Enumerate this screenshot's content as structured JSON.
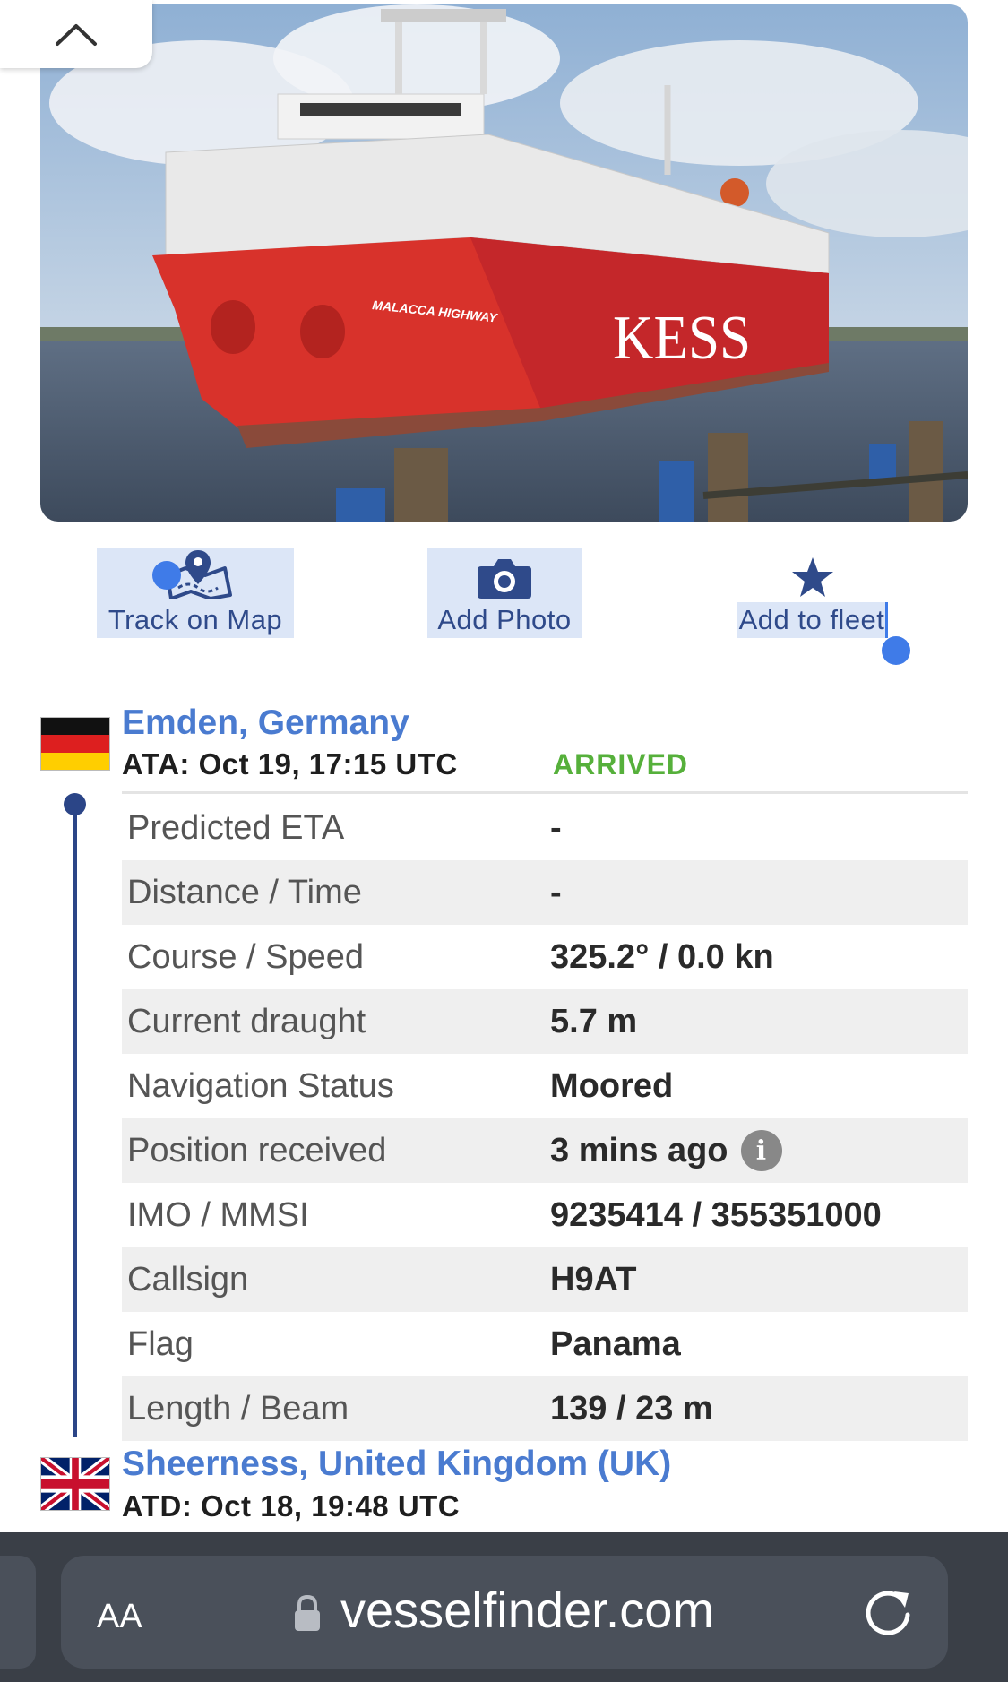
{
  "actions": {
    "track": "Track on Map",
    "photo": "Add Photo",
    "fleet": "Add to fleet"
  },
  "arrival": {
    "port": "Emden, Germany",
    "time": "ATA: Oct 19, 17:15 UTC",
    "status": "ARRIVED",
    "status_color": "#56b03b"
  },
  "departure": {
    "port": "Sheerness, United Kingdom (UK)",
    "time": "ATD: Oct 18, 19:48 UTC"
  },
  "details": [
    {
      "key": "Predicted ETA",
      "value": "-"
    },
    {
      "key": "Distance / Time",
      "value": "-"
    },
    {
      "key": "Course / Speed",
      "value": "325.2° / 0.0 kn"
    },
    {
      "key": "Current draught",
      "value": "5.7 m"
    },
    {
      "key": "Navigation Status",
      "value": "Moored"
    },
    {
      "key": "Position received",
      "value": "3 mins ago",
      "badge": "i"
    },
    {
      "key": "IMO / MMSI",
      "value": "9235414 / 355351000"
    },
    {
      "key": "Callsign",
      "value": "H9AT"
    },
    {
      "key": "Flag",
      "value": "Panama"
    },
    {
      "key": "Length / Beam",
      "value": "139 / 23 m"
    }
  ],
  "photo": {
    "hull_name": "MALACCA HIGHWAY",
    "hull_brand": "KESS"
  },
  "browser": {
    "text_size": "AA",
    "url": "vesselfinder.com"
  },
  "colors": {
    "link": "#4a7bd0",
    "timeline": "#2b4587",
    "accent": "#2f4a8a"
  }
}
